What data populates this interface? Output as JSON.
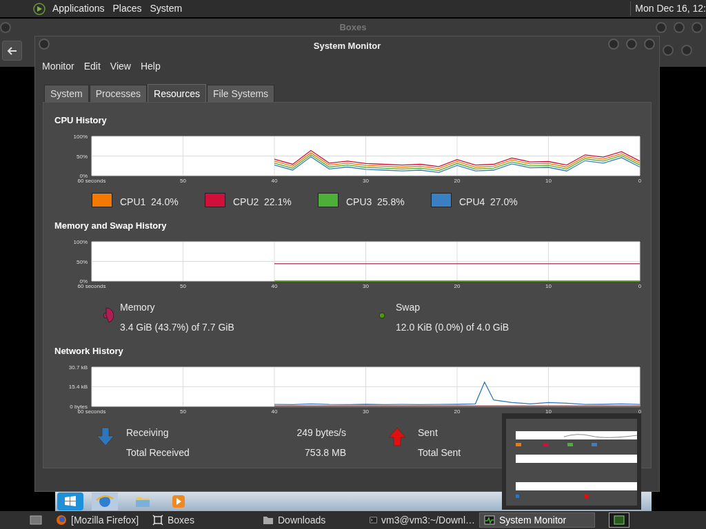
{
  "top_panel": {
    "menus": [
      "Applications",
      "Places",
      "System"
    ],
    "clock": "Mon Dec 16, 12:"
  },
  "background_window": {
    "title": "Boxes"
  },
  "window": {
    "title": "System Monitor",
    "menu": [
      "Monitor",
      "Edit",
      "View",
      "Help"
    ],
    "tabs": [
      {
        "label": "System",
        "selected": false
      },
      {
        "label": "Processes",
        "selected": false
      },
      {
        "label": "Resources",
        "selected": true
      },
      {
        "label": "File Systems",
        "selected": false
      }
    ],
    "cpu": {
      "heading": "CPU History",
      "chart_data": {
        "type": "line",
        "grid": true,
        "x": [
          40,
          38,
          36,
          34,
          32,
          30,
          28,
          26,
          24,
          22,
          20,
          18,
          16,
          14,
          12,
          10,
          8,
          6,
          4,
          2,
          0
        ],
        "xlim": [
          60,
          0
        ],
        "ylim": [
          0,
          100
        ],
        "xticks": [
          {
            "value": 60,
            "label": "60 seconds"
          },
          50,
          40,
          30,
          20,
          10,
          0
        ],
        "yticks": [
          {
            "value": 0,
            "label": "0%"
          },
          {
            "value": 50,
            "label": "50%"
          },
          {
            "value": 100,
            "label": "100%"
          }
        ],
        "series": [
          {
            "name": "CPU1",
            "color": "#f57900",
            "values": [
              37,
              24,
              58,
              27,
              32,
              26,
              24,
              22,
              24,
              18,
              36,
              22,
              24,
              40,
              30,
              31,
              22,
              48,
              42,
              56,
              32
            ]
          },
          {
            "name": "CPU2",
            "color": "#d0103a",
            "values": [
              42,
              29,
              64,
              32,
              37,
              31,
              29,
              27,
              29,
              23,
              41,
              27,
              29,
              45,
              35,
              36,
              27,
              53,
              47,
              61,
              37
            ]
          },
          {
            "name": "CPU3",
            "color": "#4caf37",
            "values": [
              32,
              19,
              53,
              22,
              27,
              21,
              19,
              17,
              19,
              13,
              31,
              17,
              19,
              35,
              25,
              26,
              17,
              43,
              37,
              51,
              27
            ]
          },
          {
            "name": "CPU4",
            "color": "#3a7fc1",
            "values": [
              27,
              14,
              48,
              17,
              22,
              16,
              14,
              12,
              14,
              8,
              26,
              12,
              14,
              30,
              20,
              21,
              12,
              38,
              32,
              46,
              22
            ]
          }
        ]
      },
      "legend": [
        {
          "value": "24.0%"
        },
        {
          "value": "22.1%"
        },
        {
          "value": "25.8%"
        },
        {
          "value": "27.0%"
        }
      ]
    },
    "memory": {
      "heading": "Memory and Swap History",
      "chart_data": {
        "type": "line",
        "grid": true,
        "x": [
          40,
          0
        ],
        "xlim": [
          60,
          0
        ],
        "ylim": [
          0,
          100
        ],
        "xticks": [
          {
            "value": 60,
            "label": "60 seconds"
          },
          50,
          40,
          30,
          20,
          10,
          0
        ],
        "yticks": [
          {
            "value": 0,
            "label": "0%"
          },
          {
            "value": 50,
            "label": "50%"
          },
          {
            "value": 100,
            "label": "100%"
          }
        ],
        "series": [
          {
            "name": "Memory",
            "color": "#ad1f54",
            "values": [
              44,
              44
            ]
          },
          {
            "name": "Swap",
            "color": "#4e9a06",
            "values": [
              0,
              0
            ]
          }
        ]
      },
      "items": [
        {
          "detail": "3.4 GiB (43.7%) of 7.7 GiB"
        },
        {
          "detail": "12.0 KiB (0.0%) of 4.0 GiB"
        }
      ]
    },
    "network": {
      "heading": "Network History",
      "chart_data": {
        "type": "line",
        "grid": true,
        "x": [
          40,
          38,
          36,
          34,
          32,
          30,
          28,
          26,
          24,
          22,
          20,
          18,
          17,
          16,
          14,
          12,
          10,
          8,
          6,
          4,
          2,
          0
        ],
        "xlim": [
          60,
          0
        ],
        "ylim": [
          0,
          30.7
        ],
        "xticks": [
          {
            "value": 60,
            "label": "60 seconds"
          },
          50,
          40,
          30,
          20,
          10,
          0
        ],
        "yticks": [
          {
            "value": 0,
            "label": "0 bytes"
          },
          {
            "value": 15.4,
            "label": "15.4 kB"
          },
          {
            "value": 30.7,
            "label": "30.7 kB"
          }
        ],
        "series": [
          {
            "name": "Receiving",
            "color": "#2e76b8",
            "values": [
              1.5,
              1.4,
              2,
              1.5,
              1.4,
              1.6,
              1.4,
              1.5,
              1.4,
              1.5,
              1.6,
              2,
              19,
              5,
              3,
              2,
              3,
              2.5,
              1.5,
              1.6,
              2,
              1.5
            ]
          },
          {
            "name": "Sent",
            "color": "#e01010",
            "values": [
              0.3,
              0.3,
              0.3,
              0.3,
              0.3,
              0.3,
              0.3,
              0.3,
              0.3,
              0.3,
              0.3,
              0.3,
              0.3,
              0.3,
              0.3,
              0.3,
              0.3,
              0.3,
              0.3,
              0.3,
              0.3,
              0.3
            ]
          }
        ]
      },
      "columns": [
        {
          "kind": "down",
          "rate": "249 bytes/s",
          "total_label": "Total Received",
          "total": "753.8 MB"
        },
        {
          "kind": "up",
          "total_label": "Total Sent"
        }
      ]
    }
  },
  "taskbar": {
    "items": [
      {
        "label": "[Mozilla Firefox]",
        "kind": "browser",
        "selected": false
      },
      {
        "label": "Boxes",
        "kind": "boxes",
        "selected": false
      },
      {
        "label": "Downloads",
        "kind": "folder",
        "selected": false
      },
      {
        "label": "vm3@vm3:~/Downl…",
        "kind": "terminal",
        "selected": false
      },
      {
        "label": "System Monitor",
        "kind": "monitor",
        "selected": true
      }
    ]
  }
}
